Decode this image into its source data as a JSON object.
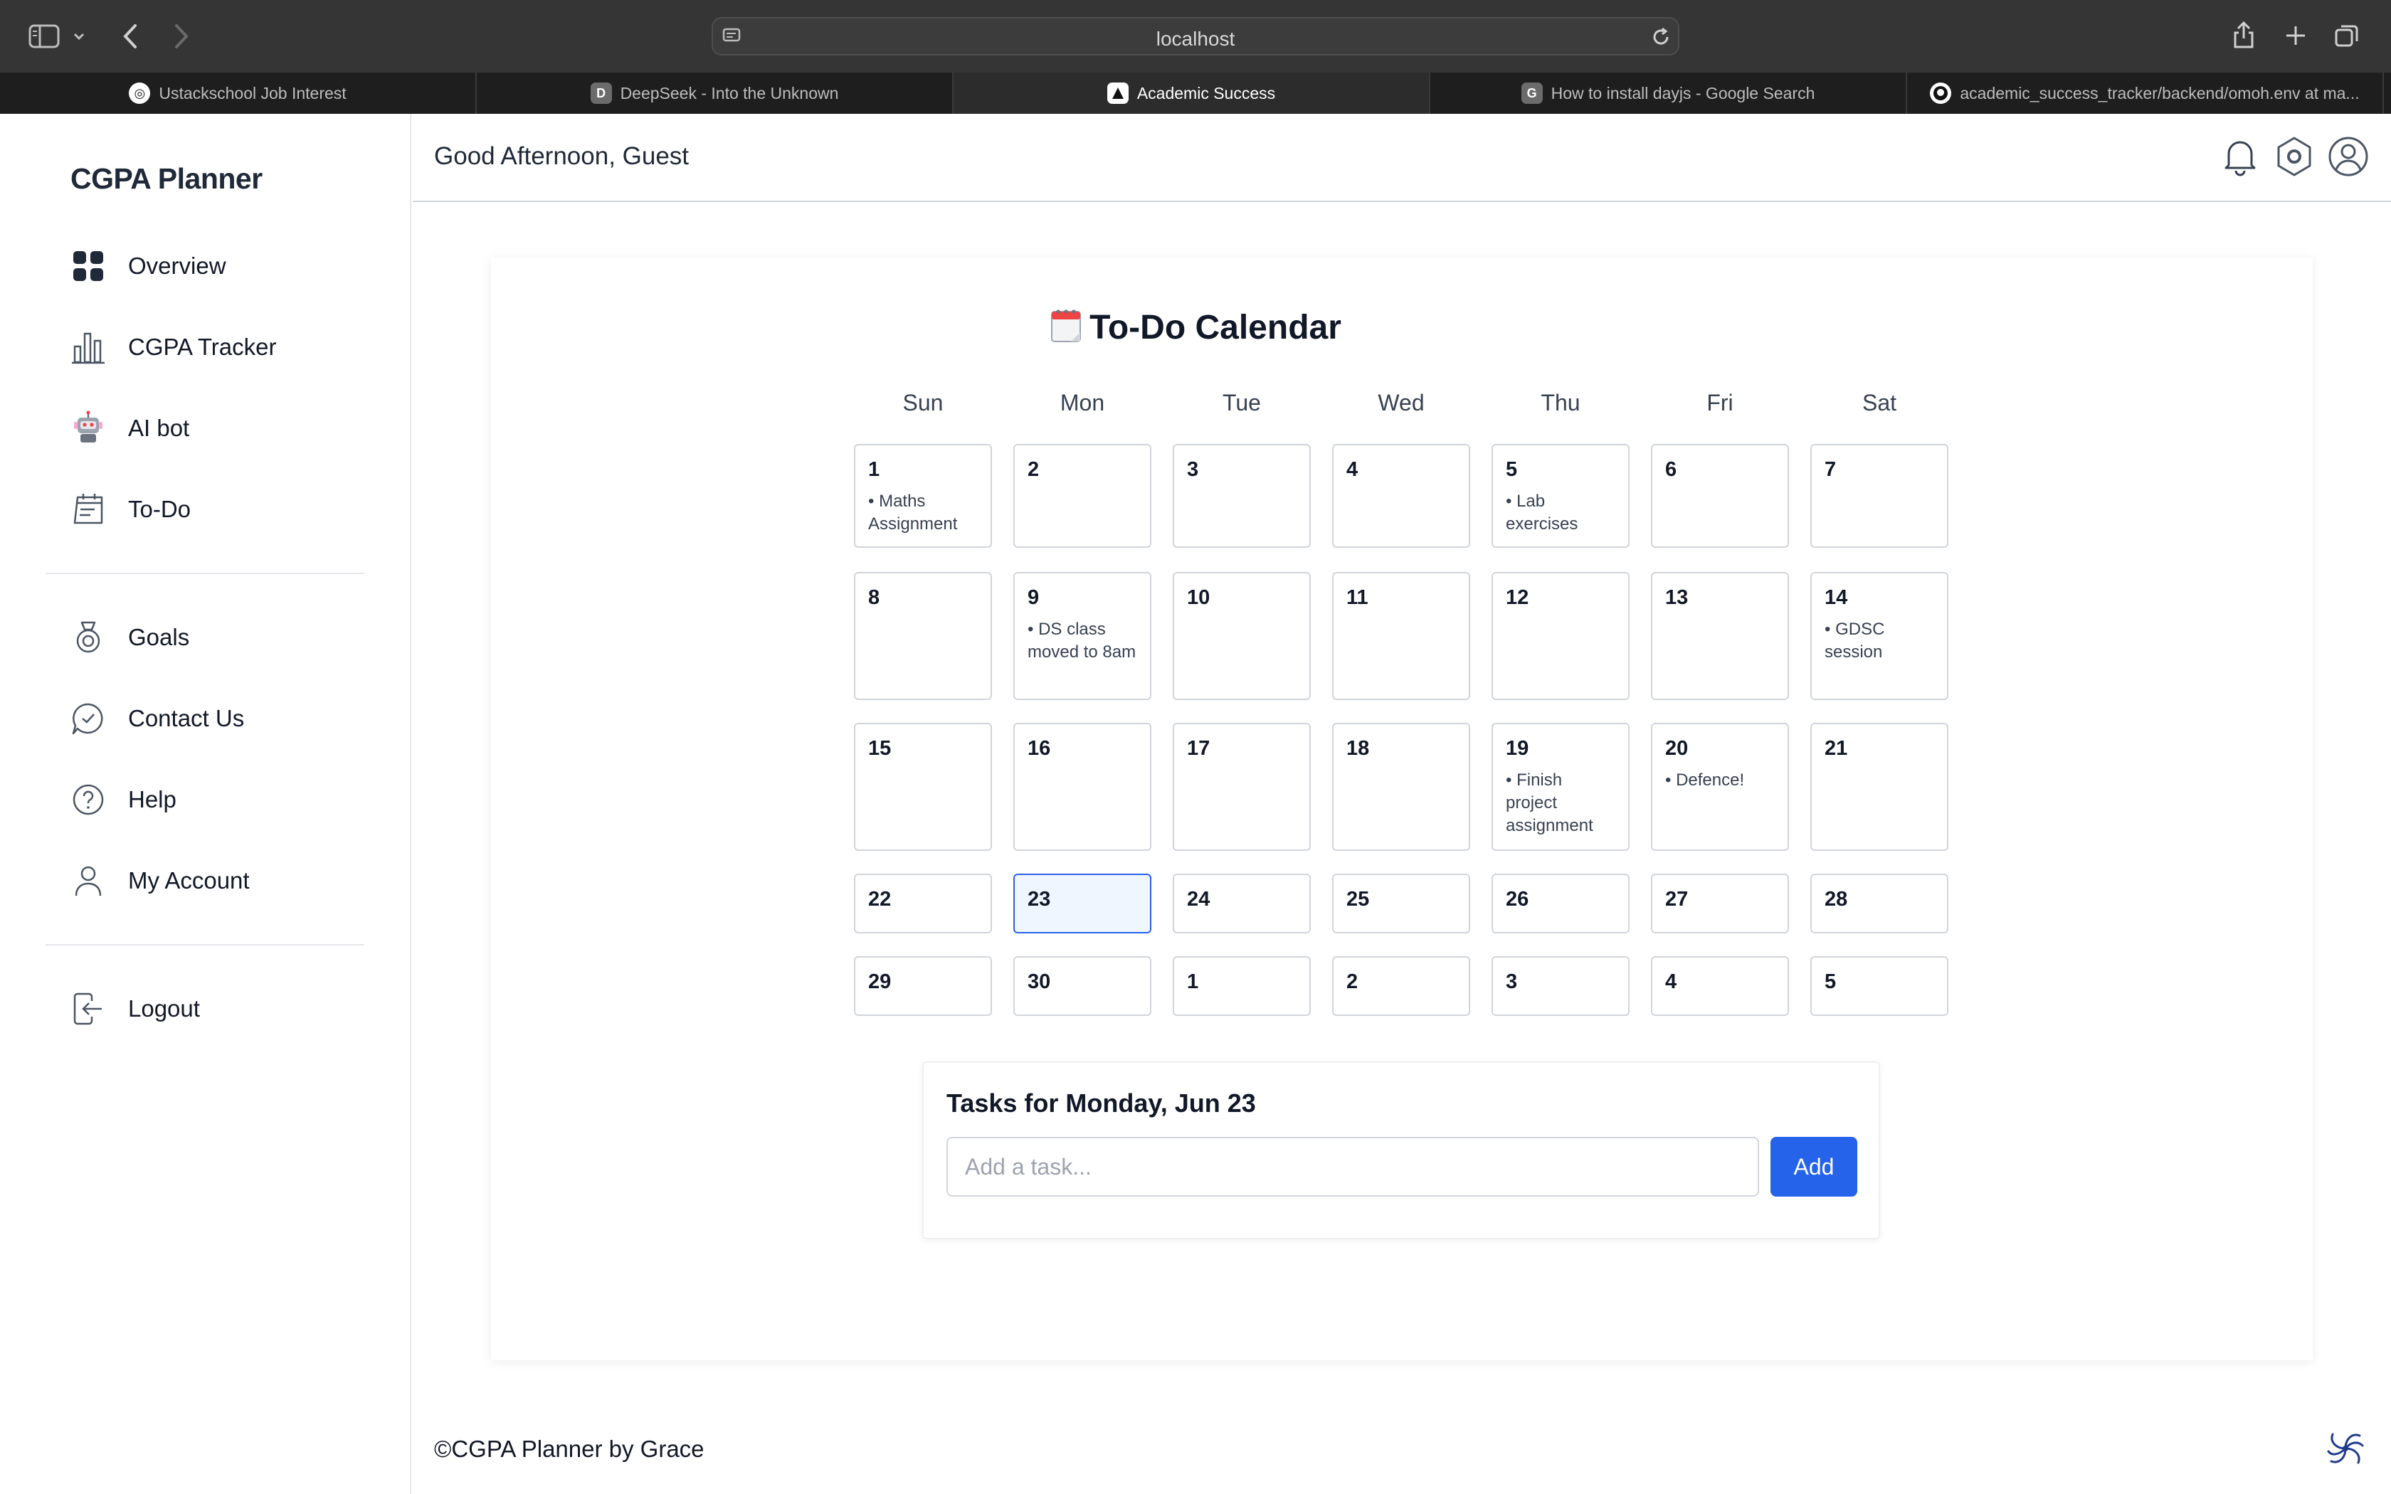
{
  "browser": {
    "address": "localhost",
    "tabs": [
      {
        "title": "Ustackschool Job Interest",
        "favicon": "U"
      },
      {
        "title": "DeepSeek - Into the Unknown",
        "favicon": "D"
      },
      {
        "title": "Academic Success",
        "favicon": "A"
      },
      {
        "title": "How to install dayjs - Google Search",
        "favicon": "G"
      },
      {
        "title": "academic_success_tracker/backend/omoh.env at ma...",
        "favicon": "github-icon"
      }
    ],
    "active_tab": 2
  },
  "sidebar": {
    "brand": "CGPA Planner",
    "items": [
      {
        "label": "Overview",
        "icon": "grid-icon"
      },
      {
        "label": "CGPA Tracker",
        "icon": "bar-chart-icon"
      },
      {
        "label": "AI bot",
        "icon": "robot-icon"
      },
      {
        "label": "To-Do",
        "icon": "calendar-icon"
      },
      {
        "label": "Goals",
        "icon": "target-icon"
      },
      {
        "label": "Contact Us",
        "icon": "chat-icon"
      },
      {
        "label": "Help",
        "icon": "help-icon"
      },
      {
        "label": "My Account",
        "icon": "user-icon"
      },
      {
        "label": "Logout",
        "icon": "logout-icon"
      }
    ]
  },
  "header": {
    "greeting": "Good Afternoon, Guest",
    "icons": [
      "bell-icon",
      "settings-icon",
      "account-icon"
    ]
  },
  "calendar": {
    "title": "To-Do Calendar",
    "title_icon": "calendar-emoji-icon",
    "weekdays": [
      "Sun",
      "Mon",
      "Tue",
      "Wed",
      "Thu",
      "Fri",
      "Sat"
    ],
    "selected_day": 23,
    "weeks": [
      [
        {
          "day": "1",
          "tasks": [
            "• Maths Assignment"
          ]
        },
        {
          "day": "2",
          "tasks": []
        },
        {
          "day": "3",
          "tasks": []
        },
        {
          "day": "4",
          "tasks": []
        },
        {
          "day": "5",
          "tasks": [
            "• Lab exercises"
          ]
        },
        {
          "day": "6",
          "tasks": []
        },
        {
          "day": "7",
          "tasks": []
        }
      ],
      [
        {
          "day": "8",
          "tasks": []
        },
        {
          "day": "9",
          "tasks": [
            "• DS class moved to 8am"
          ]
        },
        {
          "day": "10",
          "tasks": []
        },
        {
          "day": "11",
          "tasks": []
        },
        {
          "day": "12",
          "tasks": []
        },
        {
          "day": "13",
          "tasks": []
        },
        {
          "day": "14",
          "tasks": [
            "• GDSC session"
          ]
        }
      ],
      [
        {
          "day": "15",
          "tasks": []
        },
        {
          "day": "16",
          "tasks": []
        },
        {
          "day": "17",
          "tasks": []
        },
        {
          "day": "18",
          "tasks": []
        },
        {
          "day": "19",
          "tasks": [
            "• Finish project assignment"
          ]
        },
        {
          "day": "20",
          "tasks": [
            "• Defence!"
          ]
        },
        {
          "day": "21",
          "tasks": []
        }
      ],
      [
        {
          "day": "22",
          "tasks": []
        },
        {
          "day": "23",
          "tasks": [],
          "selected": true
        },
        {
          "day": "24",
          "tasks": []
        },
        {
          "day": "25",
          "tasks": []
        },
        {
          "day": "26",
          "tasks": []
        },
        {
          "day": "27",
          "tasks": []
        },
        {
          "day": "28",
          "tasks": []
        }
      ],
      [
        {
          "day": "29",
          "tasks": []
        },
        {
          "day": "30",
          "tasks": []
        },
        {
          "day": "1",
          "tasks": []
        },
        {
          "day": "2",
          "tasks": []
        },
        {
          "day": "3",
          "tasks": []
        },
        {
          "day": "4",
          "tasks": []
        },
        {
          "day": "5",
          "tasks": []
        }
      ]
    ]
  },
  "tasks_panel": {
    "heading": "Tasks for Monday, Jun 23",
    "input_placeholder": "Add a task...",
    "input_value": "",
    "add_label": "Add"
  },
  "footer": {
    "text": "©CGPA Planner by Grace"
  },
  "colors": {
    "accent": "#2563eb",
    "selected_bg": "#eff6ff",
    "cell_border": "#d1d5db",
    "chrome_bg": "#353535"
  }
}
